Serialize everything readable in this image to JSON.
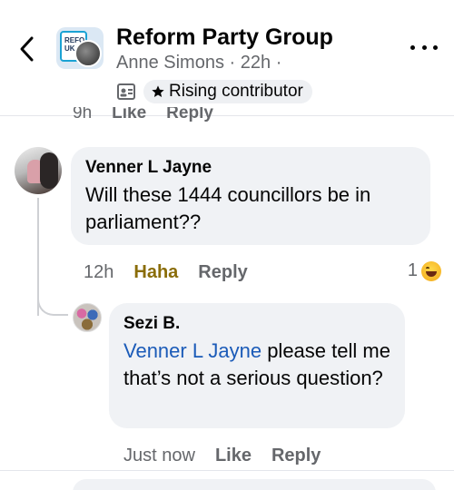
{
  "header": {
    "group_name": "Reform Party Group",
    "author": "Anne Simons",
    "time": "22h",
    "separator": "·",
    "privacy_dot": "·",
    "badge_label": "Rising contributor",
    "logo_text": "REFO UK"
  },
  "previous_comment": {
    "time": "9h",
    "like": "Like",
    "reply": "Reply"
  },
  "comments": [
    {
      "author": "Venner L Jayne",
      "text": "Will these 1444 councillors be in parliament??",
      "time": "12h",
      "reaction_label": "Haha",
      "reply": "Reply",
      "reaction_count": "1"
    },
    {
      "author": "Sezi B.",
      "mention": "Venner L Jayne",
      "text": " please tell me that’s not a serious question?",
      "time": "Just now",
      "like": "Like",
      "reply": "Reply"
    }
  ],
  "colors": {
    "bubble": "#f0f2f5",
    "mention": "#1b5bb8",
    "haha": "#8a6d09",
    "secondary_text": "#65676b"
  }
}
